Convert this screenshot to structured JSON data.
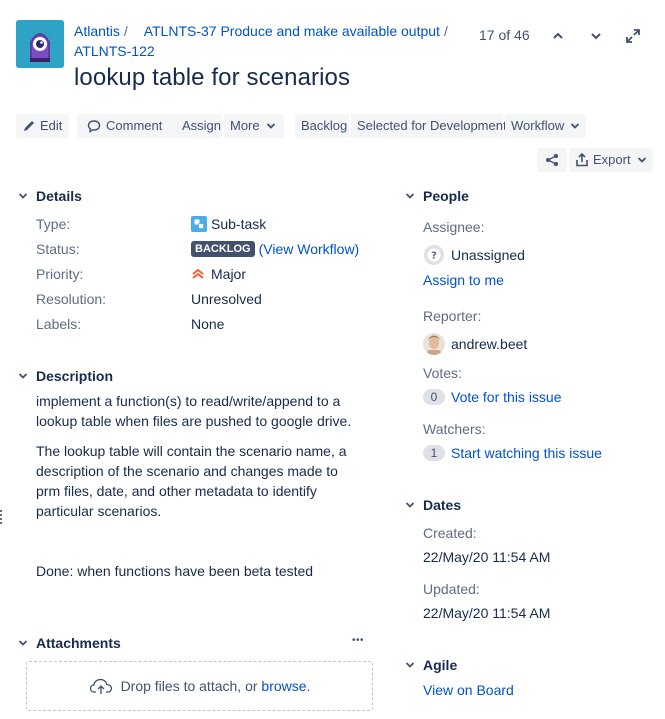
{
  "breadcrumb": {
    "project": "Atlantis",
    "parent": "ATLNTS-37 Produce and make available output",
    "issue_key": "ATLNTS-122",
    "separator": "/"
  },
  "title": "lookup table for scenarios",
  "pager": {
    "text": "17 of 46"
  },
  "toolbar": {
    "edit": "Edit",
    "comment": "Comment",
    "assign": "Assign",
    "more": "More",
    "backlog": "Backlog",
    "selected_for_development": "Selected for Development",
    "workflow": "Workflow",
    "export": "Export"
  },
  "details": {
    "heading": "Details",
    "type_label": "Type:",
    "type_value": "Sub-task",
    "status_label": "Status:",
    "status_value": "BACKLOG",
    "status_link": "(View Workflow)",
    "priority_label": "Priority:",
    "priority_value": "Major",
    "resolution_label": "Resolution:",
    "resolution_value": "Unresolved",
    "labels_label": "Labels:",
    "labels_value": "None"
  },
  "description": {
    "heading": "Description",
    "p1": "implement a function(s) to read/write/append to a lookup table when files are pushed to google drive.",
    "p2": "The lookup table will contain the scenario name, a description of the scenario and changes made to prm files, date, and other metadata to identify particular scenarios.",
    "p3": "Done: when functions have been beta tested"
  },
  "attachments": {
    "heading": "Attachments",
    "more": "•••",
    "drop_text": "Drop files to attach, or",
    "browse": "browse."
  },
  "people": {
    "heading": "People",
    "assignee_label": "Assignee:",
    "assignee_value": "Unassigned",
    "assign_to_me": "Assign to me",
    "reporter_label": "Reporter:",
    "reporter_value": "andrew.beet",
    "votes_label": "Votes:",
    "votes_count": "0",
    "vote_link": "Vote for this issue",
    "watchers_label": "Watchers:",
    "watchers_count": "1",
    "watch_link": "Start watching this issue"
  },
  "dates": {
    "heading": "Dates",
    "created_label": "Created:",
    "created_value": "22/May/20 11:54 AM",
    "updated_label": "Updated:",
    "updated_value": "22/May/20 11:54 AM"
  },
  "agile": {
    "heading": "Agile",
    "view_on_board": "View on Board"
  },
  "colors": {
    "link": "#0052cc",
    "text": "#172b4d",
    "muted": "#5e6c84",
    "button_bg": "#f4f5f7",
    "lozenge_bg": "#42526e",
    "priority_major": "#ff5630",
    "subtask_icon": "#4bade8",
    "project_avatar": "#2ea3c6"
  }
}
